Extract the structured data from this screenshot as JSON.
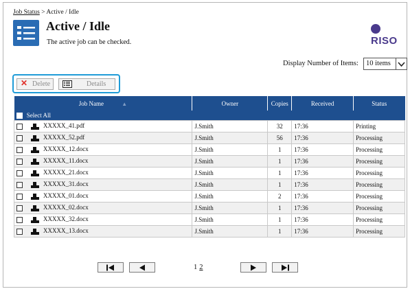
{
  "breadcrumb": {
    "link": "Job Status",
    "separator": " > ",
    "current": "Active / Idle"
  },
  "header": {
    "title": "Active / Idle",
    "subtitle": "The active job can be checked.",
    "logo": "RISO",
    "icon": "job-list-icon"
  },
  "display": {
    "label": "Display Number of Items:",
    "value": "10 items"
  },
  "toolbar": {
    "delete_label": "Delete",
    "details_label": "Details",
    "highlight_color": "#1e9bd7"
  },
  "table": {
    "columns": {
      "name": "Job Name",
      "owner": "Owner",
      "copies": "Copies",
      "received": "Received",
      "status": "Status"
    },
    "select_all": "Select All",
    "header_color": "#1e4f8f",
    "rows": [
      {
        "name": "XXXXX_41.pdf",
        "owner": "J.Smith",
        "copies": "32",
        "received": "17:36",
        "status": "Printing"
      },
      {
        "name": "XXXXX_52.pdf",
        "owner": "J.Smith",
        "copies": "56",
        "received": "17:36",
        "status": "Processing"
      },
      {
        "name": "XXXXX_12.docx",
        "owner": "J.Smith",
        "copies": "1",
        "received": "17:36",
        "status": "Processing"
      },
      {
        "name": "XXXXX_11.docx",
        "owner": "J.Smith",
        "copies": "1",
        "received": "17:36",
        "status": "Processing"
      },
      {
        "name": "XXXXX_21.docx",
        "owner": "J.Smith",
        "copies": "1",
        "received": "17:36",
        "status": "Processing"
      },
      {
        "name": "XXXXX_31.docx",
        "owner": "J.Smith",
        "copies": "1",
        "received": "17:36",
        "status": "Processing"
      },
      {
        "name": "XXXXX_01.docx",
        "owner": "J.Smith",
        "copies": "2",
        "received": "17:36",
        "status": "Processing"
      },
      {
        "name": "XXXXX_02.docx",
        "owner": "J.Smith",
        "copies": "1",
        "received": "17:36",
        "status": "Processing"
      },
      {
        "name": "XXXXX_32.docx",
        "owner": "J.Smith",
        "copies": "1",
        "received": "17:36",
        "status": "Processing"
      },
      {
        "name": "XXXXX_13.docx",
        "owner": "J.Smith",
        "copies": "1",
        "received": "17:36",
        "status": "Processing"
      }
    ]
  },
  "pagination": {
    "current": "1",
    "next_page": "2"
  }
}
